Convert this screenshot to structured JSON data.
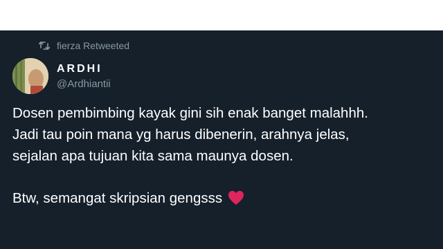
{
  "retweet": {
    "icon": "retweet-icon",
    "label": "fierza Retweeted"
  },
  "author": {
    "display_name": "ARDHI",
    "handle": "@Ardhiantii",
    "avatar_icon": "avatar"
  },
  "tweet": {
    "lines": [
      "Dosen pembimbing kayak gini sih enak banget malahhh.",
      "Jadi tau poin mana yg harus dibenerin, arahnya jelas,",
      "sejalan apa tujuan kita sama maunya dosen."
    ],
    "closing": "Btw, semangat skripsian gengsss",
    "emoji": "heart-icon"
  },
  "colors": {
    "background": "#15202b",
    "secondary_text": "#8899a6",
    "heart": "#e0245e"
  }
}
